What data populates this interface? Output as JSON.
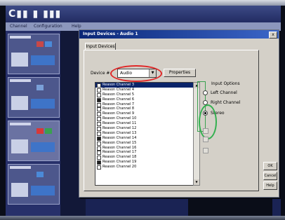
{
  "app": {
    "logo": "C",
    "menu": [
      "Channel",
      "Configuration",
      "Help"
    ]
  },
  "dialog": {
    "title": "Input Devices - Audio 1",
    "close": "x",
    "tab": "Input Devices",
    "device_label": "Device #",
    "device_value": "Audio",
    "properties_label": "Properties",
    "channels": [
      "Reason Channel 3",
      "Reason Channel 4",
      "Reason Channel 5",
      "Reason Channel 6",
      "Reason Channel 7",
      "Reason Channel 8",
      "Reason Channel 9",
      "Reason Channel 10",
      "Reason Channel 11",
      "Reason Channel 12",
      "Reason Channel 13",
      "Reason Channel 14",
      "Reason Channel 15",
      "Reason Channel 16",
      "Reason Channel 17",
      "Reason Channel 18",
      "Reason Channel 19",
      "Reason Channel 20"
    ],
    "input_options_label": "Input Options",
    "options": [
      "Left Channel",
      "Right Channel",
      "Stereo"
    ],
    "selected_option": "Stereo",
    "ok_label": "OK",
    "cancel_label": "Cancel",
    "help_label": "Help"
  }
}
